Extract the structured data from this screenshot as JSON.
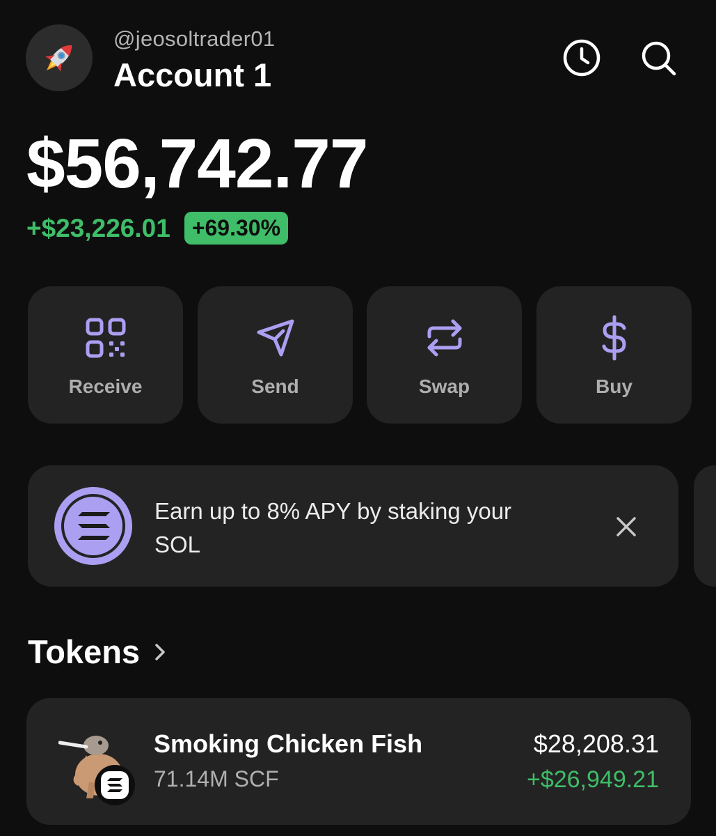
{
  "header": {
    "handle": "@jeosoltrader01",
    "account_name": "Account 1",
    "avatar_icon": "rocket-icon"
  },
  "balance": {
    "total": "$56,742.77",
    "change_amount": "+$23,226.01",
    "change_percent": "+69.30%"
  },
  "actions": [
    {
      "label": "Receive",
      "icon": "qr-code-icon"
    },
    {
      "label": "Send",
      "icon": "paper-plane-icon"
    },
    {
      "label": "Swap",
      "icon": "swap-arrows-icon"
    },
    {
      "label": "Buy",
      "icon": "dollar-icon"
    }
  ],
  "promo": {
    "text": "Earn up to 8% APY by staking your SOL",
    "icon": "solana-icon"
  },
  "tokens": {
    "title": "Tokens",
    "items": [
      {
        "name": "Smoking Chicken Fish",
        "amount": "71.14M SCF",
        "value": "$28,208.31",
        "change": "+$26,949.21"
      }
    ]
  },
  "colors": {
    "background": "#0e0e0e",
    "card": "#232323",
    "accent": "#ab9ff2",
    "positive": "#3fbd68"
  }
}
